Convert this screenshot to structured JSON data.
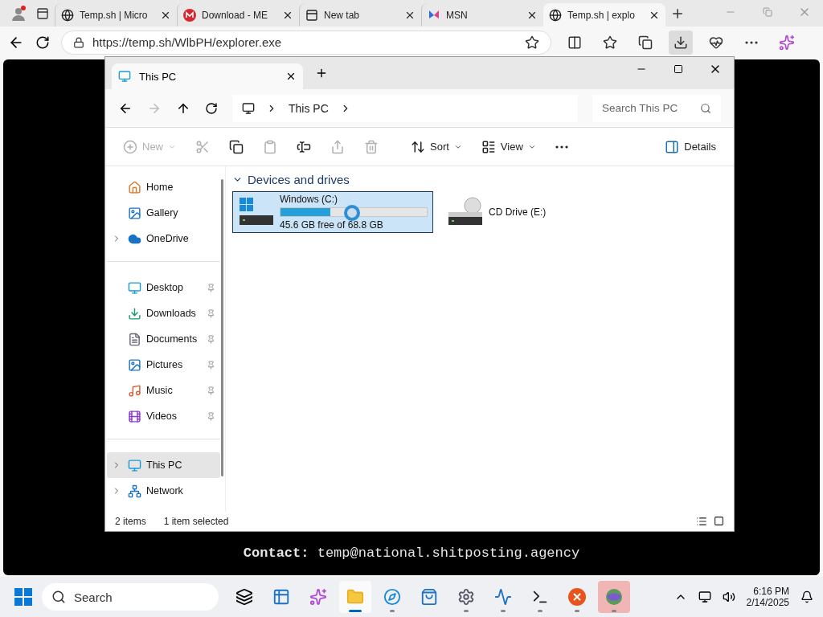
{
  "browser": {
    "tabs": [
      {
        "title": "Temp.sh | Micro",
        "kind": "globe",
        "selected": false
      },
      {
        "title": "Download - ME",
        "kind": "mega",
        "selected": false
      },
      {
        "title": "New tab",
        "kind": "newtab",
        "selected": false
      },
      {
        "title": "MSN",
        "kind": "msn",
        "selected": false
      },
      {
        "title": "Temp.sh | explo",
        "kind": "globe",
        "selected": true
      }
    ],
    "address": "https://temp.sh/WlbPH/explorer.exe"
  },
  "explorer": {
    "tab_title": "This PC",
    "breadcrumb": [
      "This PC"
    ],
    "search": {
      "placeholder": "Search This PC"
    },
    "toolbar": [
      {
        "kind": "new",
        "label": "New",
        "disabled": true
      },
      {
        "kind": "cut",
        "disabled": true
      },
      {
        "kind": "copy",
        "disabled": false
      },
      {
        "kind": "paste",
        "disabled": true
      },
      {
        "kind": "rename",
        "disabled": false
      },
      {
        "kind": "share",
        "disabled": true
      },
      {
        "kind": "delete",
        "disabled": true
      },
      {
        "kind": "sort",
        "label": "Sort",
        "disabled": false
      },
      {
        "kind": "view",
        "label": "View",
        "disabled": false
      },
      {
        "kind": "more",
        "disabled": false
      },
      {
        "kind": "details",
        "label": "Details",
        "disabled": false
      }
    ],
    "nav_sections": [
      {
        "items": [
          {
            "label": "Home",
            "kind": "home",
            "selected": false
          },
          {
            "label": "Gallery",
            "kind": "gallery",
            "selected": false
          },
          {
            "label": "OneDrive",
            "kind": "cloud",
            "expanded": false,
            "selected": false
          }
        ]
      },
      {
        "items": [
          {
            "label": "Desktop",
            "kind": "desktop",
            "pinned": true,
            "selected": false
          },
          {
            "label": "Downloads",
            "kind": "downloads",
            "pinned": true,
            "selected": false
          },
          {
            "label": "Documents",
            "kind": "documents",
            "pinned": true,
            "selected": false
          },
          {
            "label": "Pictures",
            "kind": "pictures",
            "pinned": true,
            "selected": false
          },
          {
            "label": "Music",
            "kind": "music",
            "pinned": true,
            "selected": false
          },
          {
            "label": "Videos",
            "kind": "videos",
            "pinned": true,
            "selected": false
          }
        ]
      },
      {
        "items": [
          {
            "label": "This PC",
            "kind": "pc",
            "expanded": false,
            "selected": true
          },
          {
            "label": "Network",
            "kind": "network",
            "expanded": false,
            "selected": false
          }
        ]
      }
    ],
    "group": {
      "title": "Devices and drives",
      "expanded": true
    },
    "drives": [
      {
        "name": "Windows (C:)",
        "kind": "disk",
        "selected": true,
        "level": 0.34,
        "reading": "45.6 GB free of 68.8 GB",
        "busy": true
      },
      {
        "name": "CD Drive (E:)",
        "kind": "cd",
        "selected": false
      }
    ],
    "status": {
      "count": "2 items",
      "selection": "1 item selected"
    }
  },
  "contact": "**Contact:** temp@national.shitposting.agency",
  "taskbar": {
    "search": {
      "placeholder": "Search"
    },
    "apps": [
      {
        "kind": "taskview",
        "running": false,
        "selected": false
      },
      {
        "kind": "widgets",
        "running": false,
        "selected": false
      },
      {
        "kind": "copilot",
        "running": false,
        "selected": false
      },
      {
        "kind": "explorer",
        "running": true,
        "selected": true
      },
      {
        "kind": "edge",
        "running": true,
        "selected": false
      },
      {
        "kind": "store",
        "running": false,
        "selected": false
      },
      {
        "kind": "settings",
        "running": true,
        "selected": false
      },
      {
        "kind": "monitor",
        "running": true,
        "selected": false
      },
      {
        "kind": "terminal",
        "running": true,
        "selected": false
      },
      {
        "kind": "xapp",
        "running": true,
        "selected": false
      },
      {
        "kind": "globeapp",
        "running": true,
        "selected": false,
        "attention": true
      }
    ],
    "time": "6:16 PM",
    "date": "2/14/2025"
  }
}
